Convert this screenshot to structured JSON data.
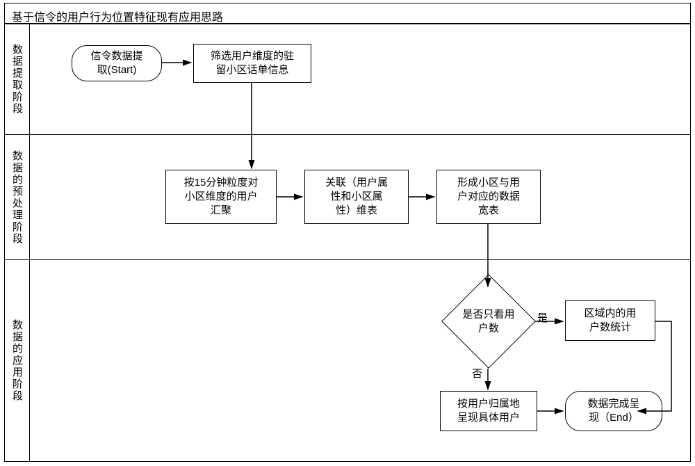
{
  "title": "基于信令的用户行为位置特征现有应用思路",
  "lanes": {
    "lane1": {
      "label": "数据提取阶段"
    },
    "lane2": {
      "label": "数据的预处理阶段"
    },
    "lane3": {
      "label": "数据的应用阶段"
    }
  },
  "nodes": {
    "start": {
      "text": "信令数据提\n取(Start)"
    },
    "filter": {
      "text": "筛选用户维度的驻\n留小区话单信息"
    },
    "agg15": {
      "text": "按15分钟粒度对\n小区维度的用户\n汇聚"
    },
    "join": {
      "text": "关联（用户属\n性和小区属\n性）维表"
    },
    "wide": {
      "text": "形成小区与用\n户对应的数据\n宽表"
    },
    "decide": {
      "text": "是否只看用\n户数"
    },
    "stat": {
      "text": "区域内的用\n户数统计"
    },
    "byhome": {
      "text": "按用户归属地\n呈现具体用户"
    },
    "end": {
      "text": "数据完成呈\n现（End）"
    }
  },
  "edges": {
    "yes": "是",
    "no": "否"
  }
}
